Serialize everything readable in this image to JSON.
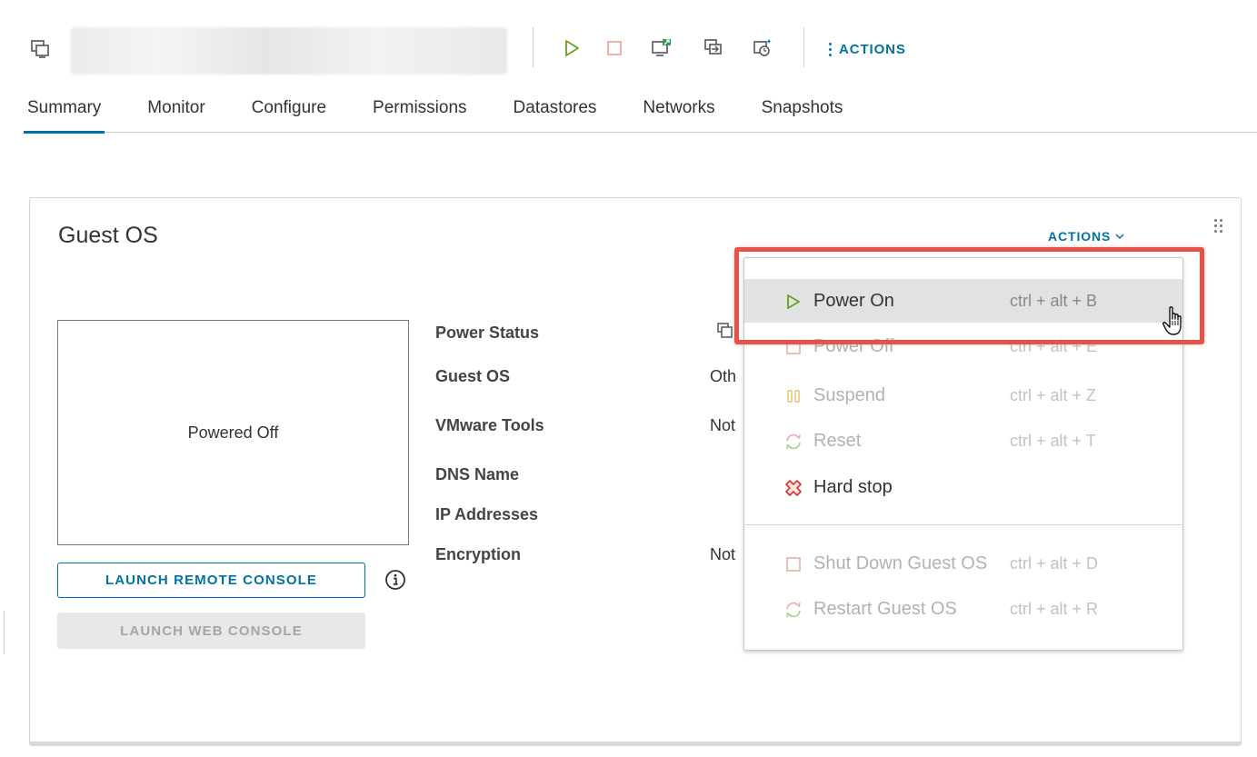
{
  "toolbar": {
    "actions_label": "ACTIONS"
  },
  "tabs": [
    {
      "label": "Summary"
    },
    {
      "label": "Monitor"
    },
    {
      "label": "Configure"
    },
    {
      "label": "Permissions"
    },
    {
      "label": "Datastores"
    },
    {
      "label": "Networks"
    },
    {
      "label": "Snapshots"
    }
  ],
  "card": {
    "title": "Guest OS",
    "actions_label": "ACTIONS",
    "console_status": "Powered Off",
    "launch_remote_console": "LAUNCH REMOTE CONSOLE",
    "launch_web_console": "LAUNCH WEB CONSOLE",
    "properties": [
      {
        "label": "Power Status",
        "value": ""
      },
      {
        "label": "Guest OS",
        "value": "Oth"
      },
      {
        "label": "VMware Tools",
        "value": "Not"
      },
      {
        "label": "DNS Name",
        "value": ""
      },
      {
        "label": "IP Addresses",
        "value": ""
      },
      {
        "label": "Encryption",
        "value": "Not"
      }
    ]
  },
  "menu": {
    "items": [
      {
        "label": "Power On",
        "shortcut": "ctrl + alt + B"
      },
      {
        "label": "Power Off",
        "shortcut": "ctrl + alt + E"
      },
      {
        "label": "Suspend",
        "shortcut": "ctrl + alt + Z"
      },
      {
        "label": "Reset",
        "shortcut": "ctrl + alt + T"
      },
      {
        "label": "Hard stop",
        "shortcut": ""
      },
      {
        "label": "Shut Down Guest OS",
        "shortcut": "ctrl + alt + D"
      },
      {
        "label": "Restart Guest OS",
        "shortcut": "ctrl + alt + R"
      }
    ]
  },
  "colors": {
    "accent": "#0072a3",
    "power_on_green": "#62a420",
    "power_off_red": "#e8b0a8",
    "suspend_yellow": "#e8c46a",
    "hard_stop_red": "#e0302b",
    "highlight": "#e4524a"
  }
}
